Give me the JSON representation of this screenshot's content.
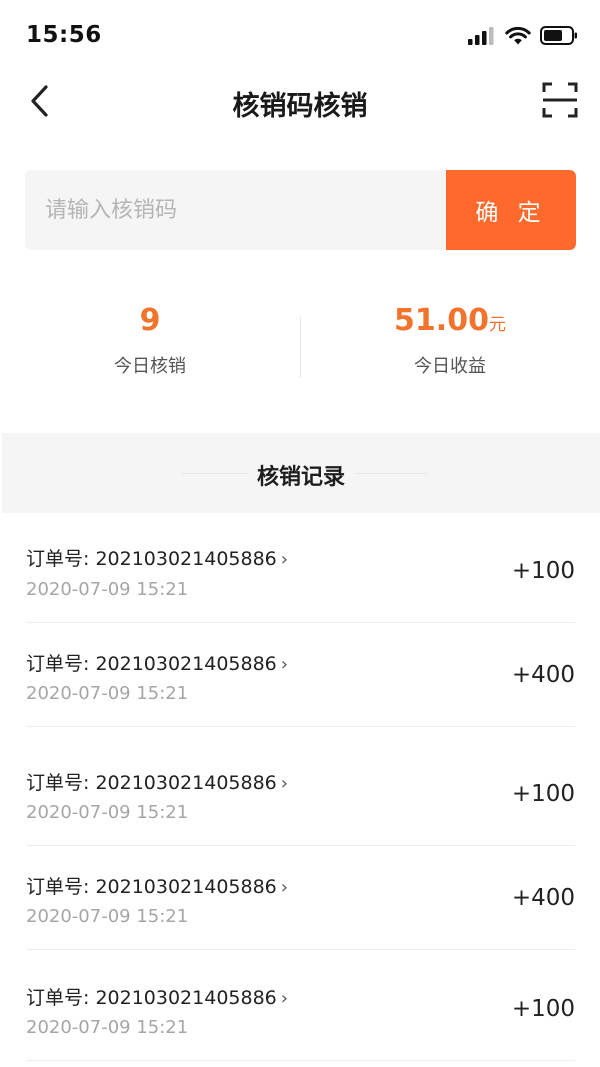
{
  "status_bar": {
    "time": "15:56"
  },
  "nav": {
    "title": "核销码核销"
  },
  "search": {
    "placeholder": "请输入核销码",
    "confirm_label": "确 定"
  },
  "stats": {
    "today_count": {
      "value": "9",
      "label": "今日核销"
    },
    "today_income": {
      "value": "51.00",
      "unit": "元",
      "label": "今日收益"
    }
  },
  "records": {
    "title": "核销记录",
    "items": [
      {
        "order_label": "订单号: 202103021405886",
        "time": "2020-07-09 15:21",
        "amount": "+100"
      },
      {
        "order_label": "订单号: 202103021405886",
        "time": "2020-07-09 15:21",
        "amount": "+400"
      },
      {
        "order_label": "订单号: 202103021405886",
        "time": "2020-07-09 15:21",
        "amount": "+100"
      },
      {
        "order_label": "订单号: 202103021405886",
        "time": "2020-07-09 15:21",
        "amount": "+400"
      },
      {
        "order_label": "订单号: 202103021405886",
        "time": "2020-07-09 15:21",
        "amount": "+100"
      }
    ]
  },
  "colors": {
    "accent": "#fd6a2c",
    "stat_value": "#f2742c",
    "section_bg": "#f5f5f5"
  },
  "icons": {
    "back": "chevron-left-icon",
    "scan": "scan-icon",
    "record_chevron": "chevron-right-icon"
  }
}
